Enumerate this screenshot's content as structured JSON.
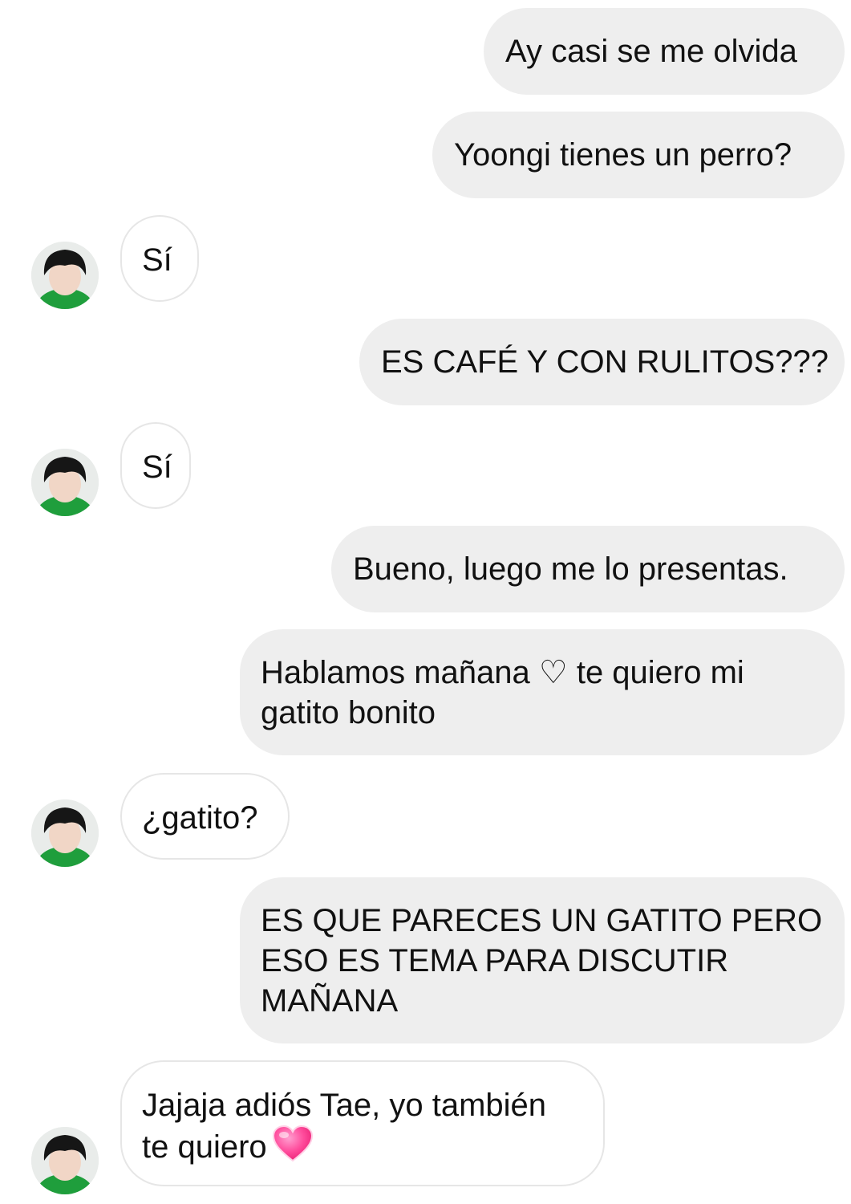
{
  "chat": {
    "colors": {
      "sent_bubble": "#eeeeee",
      "received_bubble": "#ffffff",
      "received_border": "#e6e6e6",
      "text": "#111111",
      "avatar_shirt": "#1f9e3c",
      "heart": "#ff3d8b"
    },
    "messages": [
      {
        "from": "me",
        "text": "Ay casi se me olvida"
      },
      {
        "from": "me",
        "text": "Yoongi tienes un perro?"
      },
      {
        "from": "contact",
        "text": "Sí"
      },
      {
        "from": "me",
        "text": "ES CAFÉ Y CON RULITOS???"
      },
      {
        "from": "contact",
        "text": "Sí"
      },
      {
        "from": "me",
        "text": "Bueno, luego me lo presentas."
      },
      {
        "from": "me",
        "lines": [
          "Hablamos mañana ♡ te quiero mi",
          "gatito bonito"
        ]
      },
      {
        "from": "contact",
        "text": "¿gatito?"
      },
      {
        "from": "me",
        "lines": [
          "ES QUE PARECES UN GATITO PERO",
          "ESO ES TEMA PARA DISCUTIR",
          "MAÑANA"
        ]
      },
      {
        "from": "contact",
        "lines": [
          "Jajaja adiós Tae, yo también",
          "te quiero"
        ],
        "emoji": "pink-heart-icon"
      }
    ]
  }
}
